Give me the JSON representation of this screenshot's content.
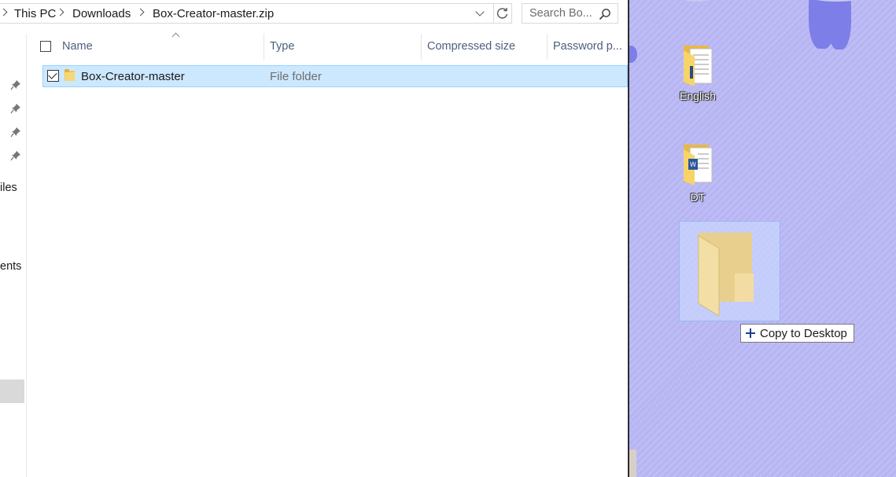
{
  "address_bar": {
    "breadcrumbs": [
      "This PC",
      "Downloads",
      "Box-Creator-master.zip"
    ]
  },
  "search": {
    "placeholder": "Search Bo..."
  },
  "nav_pane": {
    "items": [
      "iles",
      "ents"
    ]
  },
  "columns": {
    "name": "Name",
    "type": "Type",
    "compressed_size": "Compressed size",
    "password": "Password p..."
  },
  "files": [
    {
      "name": "Box-Creator-master",
      "type": "File folder",
      "selected": true,
      "checked": true
    }
  ],
  "desktop": {
    "background_color": "#b7b6f3",
    "icons": [
      {
        "label": "English",
        "icon": "document-folder-icon"
      },
      {
        "label": "DT",
        "icon": "word-document-folder-icon"
      }
    ],
    "drag_tooltip": "Copy to Desktop"
  },
  "colors": {
    "selection": "#cce8ff",
    "selection_border": "#99d1ff",
    "header_text": "#4c607a"
  }
}
